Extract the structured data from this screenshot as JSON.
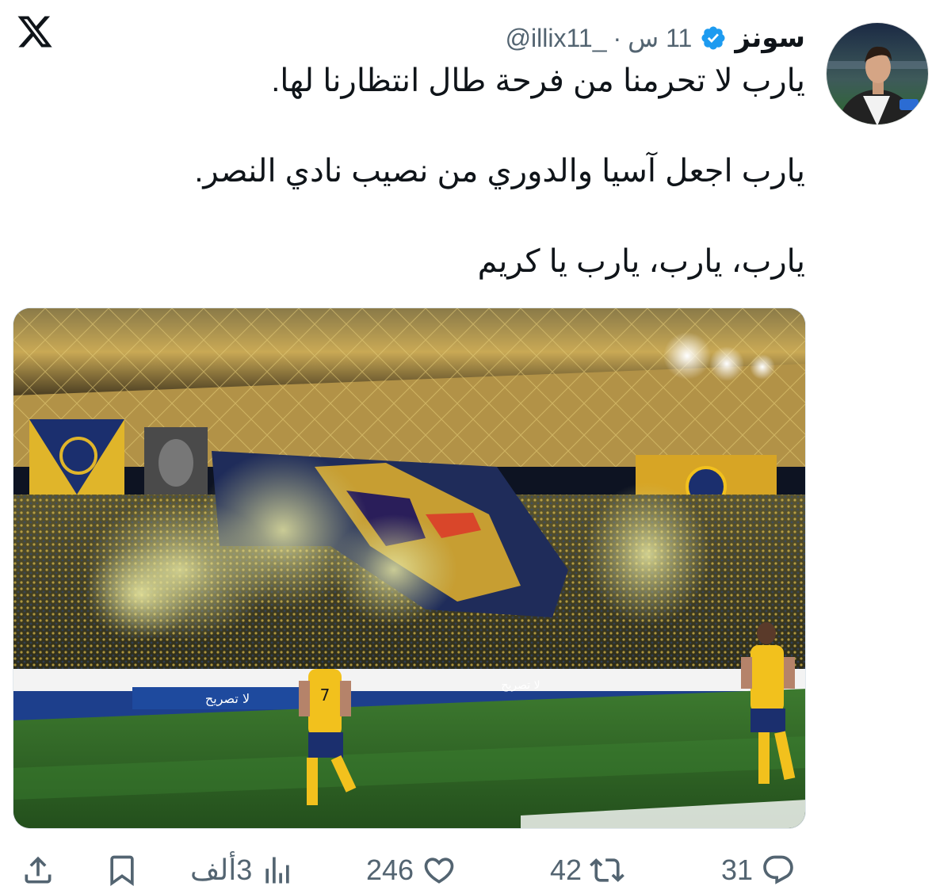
{
  "author": {
    "display_name": "سونز",
    "handle": "@illix11_",
    "separator": "·",
    "time": "11 س",
    "verified": true
  },
  "tweet": {
    "lines": [
      "يارب لا تحرمنا من فرحة طال انتظارنا لها.",
      "يارب اجعل آسيا والدوري من نصيب نادي النصر.",
      "يارب، يارب، يارب يا كريم"
    ]
  },
  "media": {
    "banner_texts": [
      "لا تصريح",
      "لا تصريح"
    ],
    "player_number": "7"
  },
  "actions": {
    "replies": "31",
    "retweets": "42",
    "likes": "246",
    "views": "3ألف"
  },
  "colors": {
    "text_primary": "#0f1419",
    "text_secondary": "#536471",
    "verified": "#1d9bf0",
    "brand_yellow": "#f2c11d",
    "brand_blue": "#1a3a8a",
    "pitch_green": "#2f6b2a"
  },
  "icons": [
    "x-logo-icon",
    "verified-icon",
    "reply-icon",
    "retweet-icon",
    "like-icon",
    "views-icon",
    "bookmark-icon",
    "share-icon"
  ]
}
